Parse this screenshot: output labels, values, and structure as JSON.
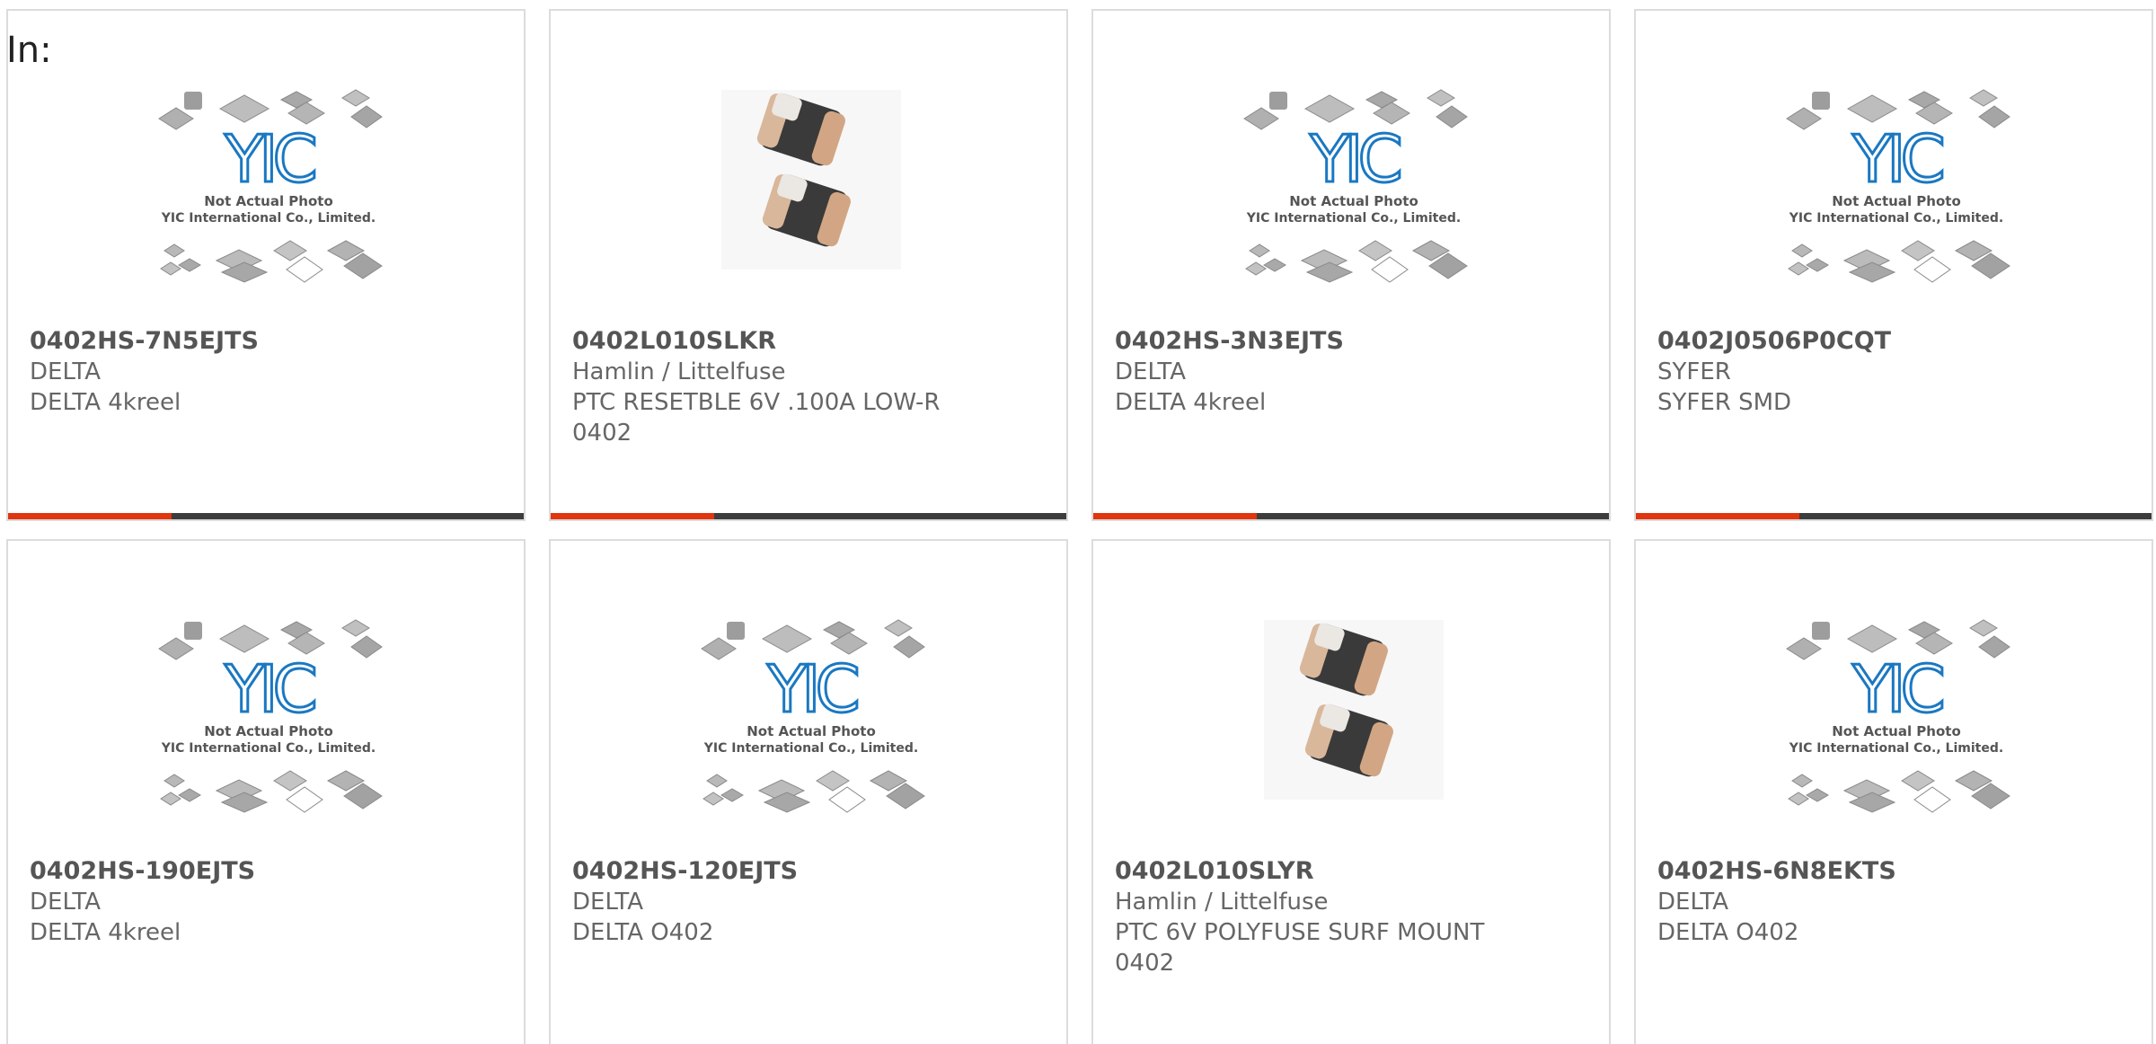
{
  "header": {
    "in_label": "In:"
  },
  "colors": {
    "accent": "#e0350f",
    "bar": "#3d3d3d",
    "yic_blue": "#1a78c2"
  },
  "placeholder_text": {
    "line1": "Not Actual Photo",
    "line2": "YIC International Co., Limited."
  },
  "products": [
    {
      "part": "0402HS-7N5EJTS",
      "maker": "DELTA",
      "desc": "DELTA 4kreel",
      "image": "yic-placeholder"
    },
    {
      "part": "0402L010SLKR",
      "maker": "Hamlin / Littelfuse",
      "desc": "PTC RESETBLE 6V .100A LOW-R 0402",
      "image": "component-photo"
    },
    {
      "part": "0402HS-3N3EJTS",
      "maker": "DELTA",
      "desc": "DELTA 4kreel",
      "image": "yic-placeholder"
    },
    {
      "part": "0402J0506P0CQT",
      "maker": "SYFER",
      "desc": "SYFER SMD",
      "image": "yic-placeholder"
    },
    {
      "part": "0402HS-190EJTS",
      "maker": "DELTA",
      "desc": "DELTA 4kreel",
      "image": "yic-placeholder"
    },
    {
      "part": "0402HS-120EJTS",
      "maker": "DELTA",
      "desc": "DELTA O402",
      "image": "yic-placeholder"
    },
    {
      "part": "0402L010SLYR",
      "maker": "Hamlin / Littelfuse",
      "desc": "PTC 6V POLYFUSE SURF MOUNT 0402",
      "image": "component-photo"
    },
    {
      "part": "0402HS-6N8EKTS",
      "maker": "DELTA",
      "desc": "DELTA O402",
      "image": "yic-placeholder"
    }
  ]
}
